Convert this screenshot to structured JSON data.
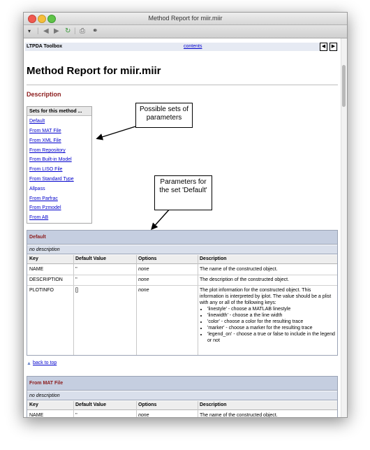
{
  "window": {
    "title": "Method Report for miir.miir"
  },
  "toolbar": {
    "dropdown_glyph": "▾",
    "back_icon": "back-arrow-icon",
    "forward_icon": "forward-arrow-icon",
    "refresh_icon": "refresh-icon",
    "print_icon": "print-icon",
    "find_icon": "binoculars-icon"
  },
  "header": {
    "toolbox_label": "LTPDA Toolbox",
    "contents_link": "contents"
  },
  "page": {
    "title": "Method Report for miir.miir",
    "section": "Description"
  },
  "sets": {
    "heading": "Sets for this method ...",
    "items": [
      {
        "label": "Default",
        "link": true
      },
      {
        "label": "From MAT File",
        "link": true
      },
      {
        "label": "From XML File",
        "link": true
      },
      {
        "label": "From Repository",
        "link": true
      },
      {
        "label": "From Built-in Model",
        "link": true
      },
      {
        "label": "From LISO File",
        "link": true
      },
      {
        "label": "From Standard Type",
        "link": true
      },
      {
        "label": "Allpass",
        "link": false
      },
      {
        "label": "From Parfrac",
        "link": true
      },
      {
        "label": "From Pzmodel",
        "link": true
      },
      {
        "label": "From AB",
        "link": true
      }
    ]
  },
  "callouts": {
    "sets": "Possible sets of parameters",
    "params": "Parameters for the set 'Default'"
  },
  "table1": {
    "title": "Default",
    "description": "no description",
    "columns": [
      "Key",
      "Default Value",
      "Options",
      "Description"
    ],
    "rows": [
      {
        "key": "NAME",
        "default": "''",
        "options": "none",
        "description": "The name of the constructed object."
      },
      {
        "key": "DESCRIPTION",
        "default": "''",
        "options": "none",
        "description": "The description of the constructed object."
      },
      {
        "key": "PLOTINFO",
        "default": "[]",
        "options": "none",
        "description": "The plot information for the constructed object. This information is interpreted by iplot. The value should be a plist with any or all of the following keys:",
        "bullets": [
          "'linestyle' - choose a MATLAB linestyle",
          "'linewidth' - choose a the line width",
          "'color' - choose a color for the resulting trace",
          "'marker' - choose a marker for the resulting trace",
          "'legend_on' - choose a true or false to include in the legend or not"
        ]
      }
    ]
  },
  "back_to_top": "back to top",
  "table2": {
    "title": "From MAT File",
    "description": "no description",
    "columns": [
      "Key",
      "Default Value",
      "Options",
      "Description"
    ],
    "rows": [
      {
        "key": "NAME",
        "default": "''",
        "options": "none",
        "description": "The name of the constructed object."
      }
    ]
  }
}
